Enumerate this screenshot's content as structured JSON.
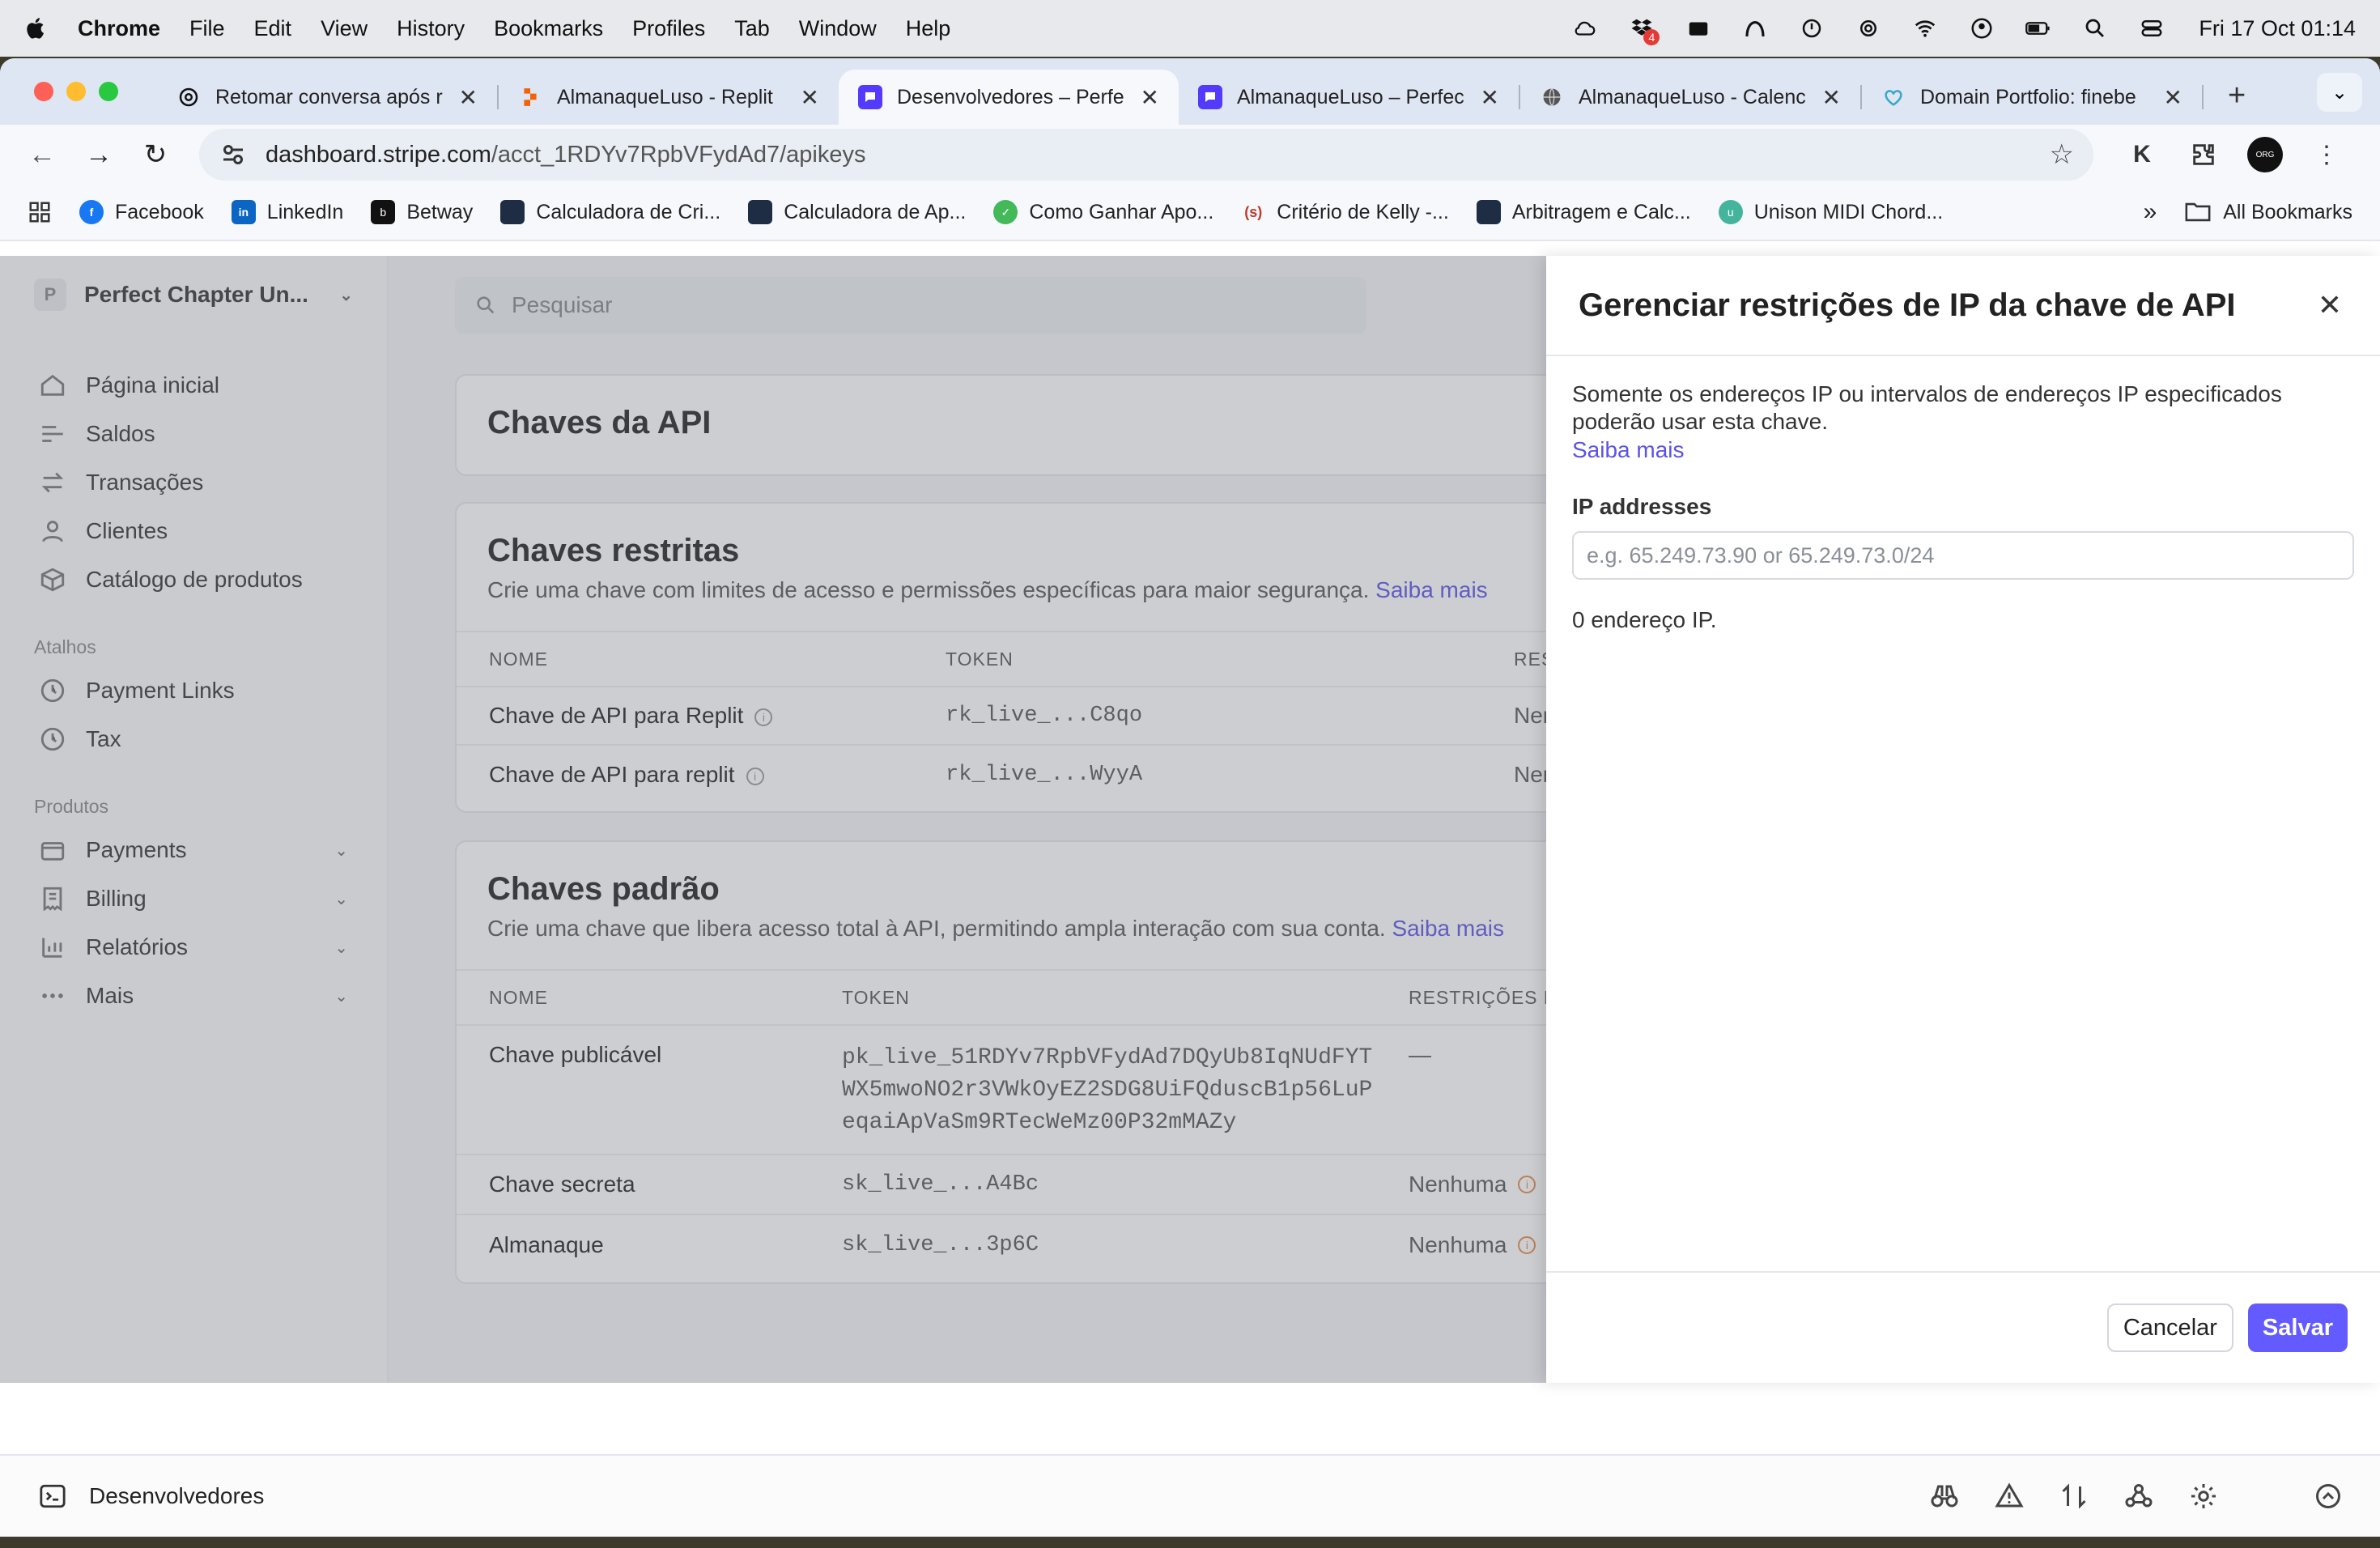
{
  "menubar": {
    "app": "Chrome",
    "items": [
      "File",
      "Edit",
      "View",
      "History",
      "Bookmarks",
      "Profiles",
      "Tab",
      "Window",
      "Help"
    ],
    "badge": "4",
    "clock": "Fri 17 Oct  01:14"
  },
  "tabs": [
    {
      "title": "Retomar conversa após r",
      "icon": "chatgpt-icon"
    },
    {
      "title": "AlmanaqueLuso - Replit",
      "icon": "replit-icon"
    },
    {
      "title": "Desenvolvedores – Perfe",
      "icon": "stripe-icon"
    },
    {
      "title": "AlmanaqueLuso – Perfec",
      "icon": "stripe-icon"
    },
    {
      "title": "AlmanaqueLuso - Calenc",
      "icon": "globe-icon"
    },
    {
      "title": "Domain Portfolio: finebe",
      "icon": "domain-icon"
    }
  ],
  "address": {
    "url_host": "dashboard.stripe.com",
    "url_path": "/acct_1RDYv7RpbVFydAd7/apikeys"
  },
  "toolbar": {
    "avatar_text": "ORG"
  },
  "bookmarks": [
    {
      "label": "Facebook",
      "color": "#1877f2",
      "glyph": "f"
    },
    {
      "label": "LinkedIn",
      "color": "#0a66c2",
      "glyph": "in"
    },
    {
      "label": "Betway",
      "color": "#111111",
      "glyph": "b"
    },
    {
      "label": "Calculadora de Cri...",
      "color": "#1f2d44",
      "glyph": ""
    },
    {
      "label": "Calculadora de Ap...",
      "color": "#1f2d44",
      "glyph": ""
    },
    {
      "label": "Como Ganhar Apo...",
      "color": "#43b95a",
      "glyph": "✓"
    },
    {
      "label": "Critério de Kelly -...",
      "color": "#ffffff",
      "glyph": "(s)"
    },
    {
      "label": "Arbitragem e Calc...",
      "color": "#1f2d44",
      "glyph": ""
    },
    {
      "label": "Unison MIDI Chord...",
      "color": "#44b59c",
      "glyph": "u"
    }
  ],
  "all_bookmarks": "All Bookmarks",
  "sidebar": {
    "account_initial": "P",
    "account": "Perfect Chapter Un...",
    "items": [
      {
        "label": "Página inicial"
      },
      {
        "label": "Saldos"
      },
      {
        "label": "Transações"
      },
      {
        "label": "Clientes"
      },
      {
        "label": "Catálogo de produtos"
      }
    ],
    "shortcuts_title": "Atalhos",
    "shortcuts": [
      {
        "label": "Payment Links"
      },
      {
        "label": "Tax"
      }
    ],
    "products_title": "Produtos",
    "products": [
      {
        "label": "Payments"
      },
      {
        "label": "Billing"
      },
      {
        "label": "Relatórios"
      },
      {
        "label": "Mais"
      }
    ]
  },
  "search": {
    "placeholder": "Pesquisar"
  },
  "api_keys": {
    "title": "Chaves da API"
  },
  "restricted": {
    "title": "Chaves restritas",
    "desc": "Crie uma chave com limites de acesso e permissões específicas para maior segurança.",
    "link": "Saiba mais",
    "headers": [
      "NOME",
      "TOKEN",
      "RES"
    ],
    "rows": [
      {
        "name": "Chave de API para Replit",
        "token": "rk_live_...C8qo",
        "restr": "Nen"
      },
      {
        "name": "Chave de API para replit",
        "token": "rk_live_...WyyA",
        "restr": "Nen"
      }
    ]
  },
  "standard": {
    "title": "Chaves padrão",
    "desc": "Crie uma chave que libera acesso total à API, permitindo ampla interação com sua conta.",
    "link": "Saiba mais",
    "headers": [
      "NOME",
      "TOKEN",
      "RESTRIÇÕES DE"
    ],
    "rows": [
      {
        "name": "Chave publicável",
        "token_lines": [
          "pk_live_51RDYv7RpbVFydAd7DQyUb8IqNUdFYT",
          "WX5mwoNO2r3VWkOyEZ2SDG8UiFQduscB1p56LuP",
          "eqaiApVaSm9RTecWeMz00P32mMAZy"
        ],
        "restr": "—"
      },
      {
        "name": "Chave secreta",
        "token": "sk_live_...A4Bc",
        "restr": "Nenhuma"
      },
      {
        "name": "Almanaque",
        "token": "sk_live_...3p6C",
        "restr": "Nenhuma"
      }
    ]
  },
  "drawer": {
    "title": "Gerenciar restrições de IP da chave de API",
    "text": "Somente os endereços IP ou intervalos de endereços IP especificados poderão usar esta chave.",
    "link": "Saiba mais",
    "field_label": "IP addresses",
    "input_placeholder": "e.g. 65.249.73.90 or 65.249.73.0/24",
    "input_value": "",
    "count": "0 endereço IP.",
    "cancel": "Cancelar",
    "save": "Salvar"
  },
  "devbar": {
    "label": "Desenvolvedores"
  },
  "colors": {
    "accent": "#635bff",
    "link": "#5b52e6"
  }
}
